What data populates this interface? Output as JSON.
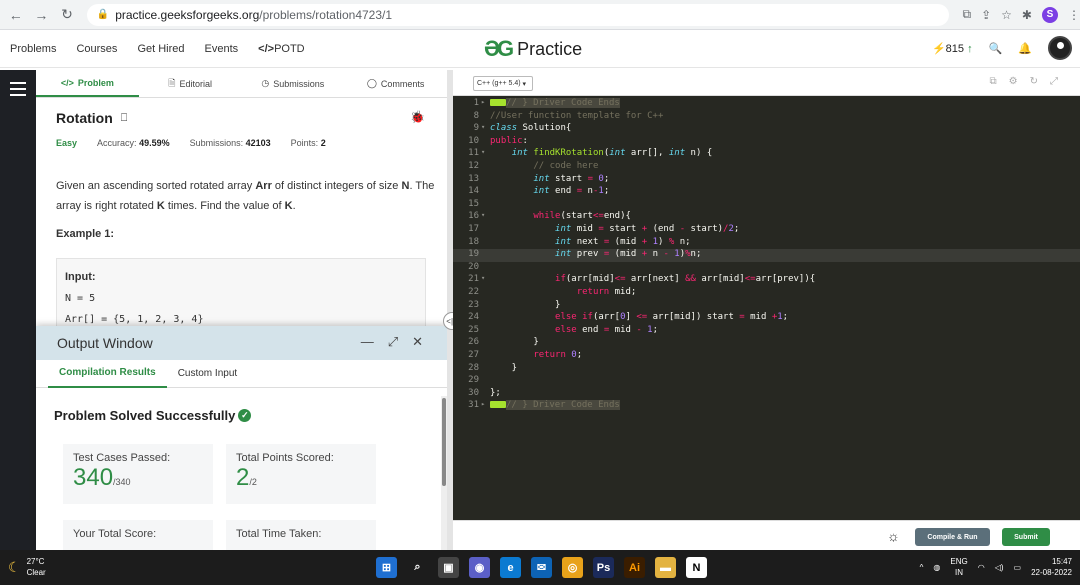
{
  "browser": {
    "url_host": "practice.geeksforgeeks.org",
    "url_path": "/problems/rotation4723/1",
    "profile_initial": "S"
  },
  "header": {
    "nav": [
      "Problems",
      "Courses",
      "Get Hired",
      "Events",
      "POTD"
    ],
    "logo_text": "Practice",
    "streak": "815"
  },
  "problem_tabs": [
    "Problem",
    "Editorial",
    "Submissions",
    "Comments"
  ],
  "problem": {
    "title": "Rotation",
    "difficulty": "Easy",
    "accuracy_label": "Accuracy:",
    "accuracy": "49.59%",
    "submissions_label": "Submissions:",
    "submissions": "42103",
    "points_label": "Points:",
    "points": "2",
    "desc_1": "Given an ascending sorted rotated array ",
    "desc_arr": "Arr",
    "desc_2": " of distinct integers of size ",
    "desc_n": "N",
    "desc_3": ". The array is right rotated ",
    "desc_k": "K",
    "desc_4": " times. Find the value of ",
    "desc_k2": "K",
    "desc_5": ".",
    "example_heading": "Example 1:",
    "input_label": "Input:",
    "input_line1": "N = 5",
    "input_line2": "Arr[] = {5, 1, 2, 3, 4}"
  },
  "output_window": {
    "title": "Output Window",
    "tabs": [
      "Compilation Results",
      "Custom Input"
    ],
    "status": "Problem Solved Successfully",
    "cards": [
      {
        "label": "Test Cases Passed:",
        "value": "340",
        "total": "/340"
      },
      {
        "label": "Total Points Scored:",
        "value": "2",
        "total": "/2"
      },
      {
        "label": "Your Total Score:",
        "value": "",
        "total": ""
      },
      {
        "label": "Total Time Taken:",
        "value": "",
        "total": ""
      }
    ]
  },
  "editor": {
    "language": "C++ (g++ 5.4)",
    "run_label": "Compile & Run",
    "submit_label": "Submit"
  },
  "taskbar": {
    "temp": "27°C",
    "weather": "Clear",
    "lang_top": "ENG",
    "lang_bottom": "IN",
    "time": "15:47",
    "date": "22-08-2022"
  },
  "colors": {
    "brand_green": "#2f8d46",
    "editor_bg": "#272822",
    "output_header": "#d4e3ea"
  }
}
